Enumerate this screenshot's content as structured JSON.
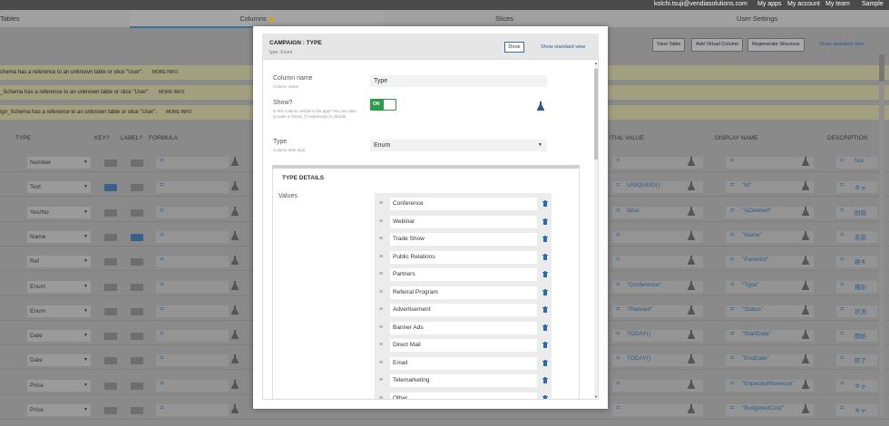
{
  "topbar": {
    "email": "kolchi.tsuji@vendiasolutions.com",
    "my_apps": "My apps",
    "my_account": "My account",
    "my_team": "My team",
    "user": "Sample"
  },
  "tabs": {
    "tables": "Tables",
    "columns": "Columns",
    "slices": "Slices",
    "ux_settings": "User Settings"
  },
  "toolbar": {
    "view_table": "View Table",
    "add_virtual_column": "Add Virtual Column",
    "regenerate_structure": "Regenerate Structure",
    "show_standard_view": "Show standard view"
  },
  "warnings": [
    {
      "text": "chema has a reference to an unknown table or slice \"User\".",
      "more": "MORE INFO"
    },
    {
      "text": "_Schema has a reference to an unknown table or slice \"User\".",
      "more": "MORE INFO"
    },
    {
      "text": "ign_Schema has a reference to an unknown table or slice \"User\".",
      "more": "MORE INFO"
    }
  ],
  "columns_header": {
    "type": "TYPE",
    "key": "KEY?",
    "label": "LABEL?",
    "formula": "FORMULA",
    "initial_value": "ITIAL VALUE",
    "display_name": "DISPLAY NAME",
    "description": "DESCRIPTION"
  },
  "rows": [
    {
      "type": "Number",
      "key": false,
      "label": false,
      "initial": "",
      "display": "",
      "desc": "Nor"
    },
    {
      "type": "Text",
      "key": true,
      "label": false,
      "initial": "UNIQUEID()",
      "display": "\"Id\"",
      "desc": "キャ"
    },
    {
      "type": "Yes/No",
      "key": false,
      "label": false,
      "initial": "false",
      "display": "\"IsDeleted\"",
      "desc": "削除"
    },
    {
      "type": "Name",
      "key": false,
      "label": true,
      "initial": "",
      "display": "\"Name\"",
      "desc": "名前"
    },
    {
      "type": "Ref",
      "key": false,
      "label": false,
      "initial": "",
      "display": "\"ParentId\"",
      "desc": "親キ"
    },
    {
      "type": "Enum",
      "key": false,
      "label": false,
      "initial": "\"Conference\"",
      "display": "\"Type\"",
      "desc": "種別"
    },
    {
      "type": "Enum",
      "key": false,
      "label": false,
      "initial": "\"Planned\"",
      "display": "\"Status\"",
      "desc": "状況"
    },
    {
      "type": "Date",
      "key": false,
      "label": false,
      "initial": "TODAY()",
      "display": "\"StartDate\"",
      "desc": "開始"
    },
    {
      "type": "Date",
      "key": false,
      "label": false,
      "initial": "TODAY()",
      "display": "\"EndDate\"",
      "desc": "終了"
    },
    {
      "type": "Price",
      "key": false,
      "label": false,
      "initial": "",
      "display": "\"ExpectedRevenue\"",
      "desc": "キャ"
    },
    {
      "type": "Price",
      "key": false,
      "label": false,
      "initial": "",
      "display": "\"BudgetedCost\"",
      "desc": "キャ"
    }
  ],
  "modal": {
    "title": "CAMPAIGN : TYPE",
    "subtitle": "type: Enum",
    "done": "Done",
    "show_standard_view": "Show standard view",
    "column_name_label": "Column name",
    "column_name_sub": "Column name",
    "column_name_value": "Type",
    "show_label": "Show?",
    "show_sub": "Is this column visible in the app? You can also provide a 'Show_If' expression to decide.",
    "show_on": "ON",
    "type_label": "Type",
    "type_sub": "Column data type",
    "type_value": "Enum",
    "details_title": "TYPE DETAILS",
    "values_label": "Values",
    "values": [
      "Conference",
      "Webinar",
      "Trade Show",
      "Public Relations",
      "Partners",
      "Referral Program",
      "Advertisement",
      "Banner Ads",
      "Direct Mail",
      "Email",
      "Telemarketing",
      "Other"
    ]
  }
}
